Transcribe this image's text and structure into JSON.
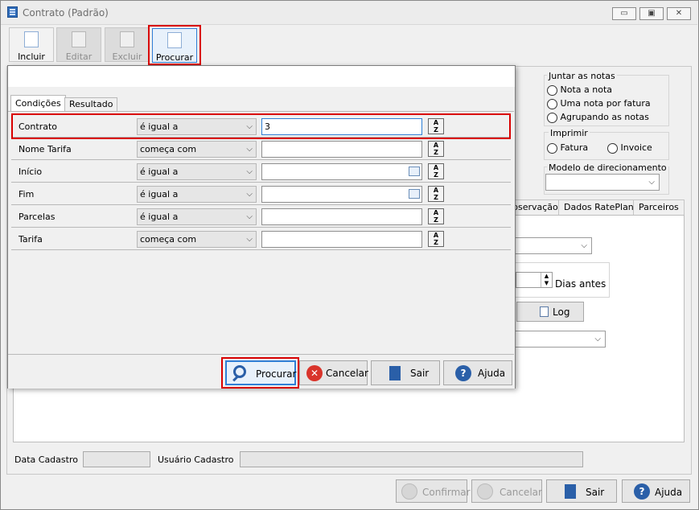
{
  "window": {
    "title": "Contrato (Padrão)",
    "btn_min": "▭",
    "btn_max": "▣",
    "btn_close": "✕"
  },
  "toolbar": {
    "incluir": "Incluir",
    "editar": "Editar",
    "excluir": "Excluir",
    "procurar": "Procurar"
  },
  "bg": {
    "juntar_title": "Juntar as notas",
    "nota_a_nota": "Nota a nota",
    "uma_nota_fatura": "Uma nota por fatura",
    "agrupando": "Agrupando as notas",
    "imprimir_title": "Imprimir",
    "fatura": "Fatura",
    "invoice": "Invoice",
    "modelo_title": "Modelo de direcionamento",
    "tabs": [
      "bservação",
      "Dados RatePlan",
      "Parceiros"
    ],
    "dias_antes": "Dias antes",
    "log": "Log",
    "data_cadastro": "Data Cadastro",
    "usuario_cadastro": "Usuário Cadastro",
    "confirmar": "Confirmar",
    "cancelar": "Cancelar",
    "sair": "Sair",
    "ajuda": "Ajuda"
  },
  "dialog": {
    "tabs": [
      "Condições",
      "Resultado"
    ],
    "rows": [
      {
        "label": "Contrato",
        "op": "é igual a",
        "value": "3"
      },
      {
        "label": "Nome Tarifa",
        "op": "começa com",
        "value": ""
      },
      {
        "label": "Início",
        "op": "é igual a",
        "value": ""
      },
      {
        "label": "Fim",
        "op": "é igual a",
        "value": ""
      },
      {
        "label": "Parcelas",
        "op": "é igual a",
        "value": ""
      },
      {
        "label": "Tarifa",
        "op": "começa com",
        "value": ""
      }
    ],
    "procurar": "Procurar",
    "cancelar": "Cancelar",
    "sair": "Sair",
    "ajuda": "Ajuda"
  },
  "colors": {
    "highlight": "#d90000",
    "focus": "#2f7fd6"
  }
}
